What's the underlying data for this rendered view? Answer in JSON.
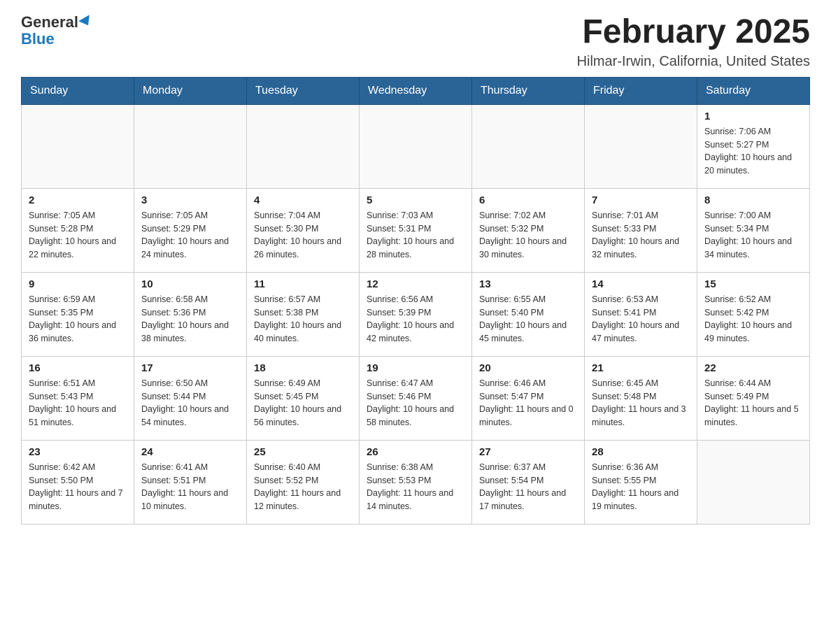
{
  "header": {
    "logo_general": "General",
    "logo_blue": "Blue",
    "month_title": "February 2025",
    "location": "Hilmar-Irwin, California, United States"
  },
  "weekdays": [
    "Sunday",
    "Monday",
    "Tuesday",
    "Wednesday",
    "Thursday",
    "Friday",
    "Saturday"
  ],
  "weeks": [
    [
      {
        "day": "",
        "sunrise": "",
        "sunset": "",
        "daylight": ""
      },
      {
        "day": "",
        "sunrise": "",
        "sunset": "",
        "daylight": ""
      },
      {
        "day": "",
        "sunrise": "",
        "sunset": "",
        "daylight": ""
      },
      {
        "day": "",
        "sunrise": "",
        "sunset": "",
        "daylight": ""
      },
      {
        "day": "",
        "sunrise": "",
        "sunset": "",
        "daylight": ""
      },
      {
        "day": "",
        "sunrise": "",
        "sunset": "",
        "daylight": ""
      },
      {
        "day": "1",
        "sunrise": "Sunrise: 7:06 AM",
        "sunset": "Sunset: 5:27 PM",
        "daylight": "Daylight: 10 hours and 20 minutes."
      }
    ],
    [
      {
        "day": "2",
        "sunrise": "Sunrise: 7:05 AM",
        "sunset": "Sunset: 5:28 PM",
        "daylight": "Daylight: 10 hours and 22 minutes."
      },
      {
        "day": "3",
        "sunrise": "Sunrise: 7:05 AM",
        "sunset": "Sunset: 5:29 PM",
        "daylight": "Daylight: 10 hours and 24 minutes."
      },
      {
        "day": "4",
        "sunrise": "Sunrise: 7:04 AM",
        "sunset": "Sunset: 5:30 PM",
        "daylight": "Daylight: 10 hours and 26 minutes."
      },
      {
        "day": "5",
        "sunrise": "Sunrise: 7:03 AM",
        "sunset": "Sunset: 5:31 PM",
        "daylight": "Daylight: 10 hours and 28 minutes."
      },
      {
        "day": "6",
        "sunrise": "Sunrise: 7:02 AM",
        "sunset": "Sunset: 5:32 PM",
        "daylight": "Daylight: 10 hours and 30 minutes."
      },
      {
        "day": "7",
        "sunrise": "Sunrise: 7:01 AM",
        "sunset": "Sunset: 5:33 PM",
        "daylight": "Daylight: 10 hours and 32 minutes."
      },
      {
        "day": "8",
        "sunrise": "Sunrise: 7:00 AM",
        "sunset": "Sunset: 5:34 PM",
        "daylight": "Daylight: 10 hours and 34 minutes."
      }
    ],
    [
      {
        "day": "9",
        "sunrise": "Sunrise: 6:59 AM",
        "sunset": "Sunset: 5:35 PM",
        "daylight": "Daylight: 10 hours and 36 minutes."
      },
      {
        "day": "10",
        "sunrise": "Sunrise: 6:58 AM",
        "sunset": "Sunset: 5:36 PM",
        "daylight": "Daylight: 10 hours and 38 minutes."
      },
      {
        "day": "11",
        "sunrise": "Sunrise: 6:57 AM",
        "sunset": "Sunset: 5:38 PM",
        "daylight": "Daylight: 10 hours and 40 minutes."
      },
      {
        "day": "12",
        "sunrise": "Sunrise: 6:56 AM",
        "sunset": "Sunset: 5:39 PM",
        "daylight": "Daylight: 10 hours and 42 minutes."
      },
      {
        "day": "13",
        "sunrise": "Sunrise: 6:55 AM",
        "sunset": "Sunset: 5:40 PM",
        "daylight": "Daylight: 10 hours and 45 minutes."
      },
      {
        "day": "14",
        "sunrise": "Sunrise: 6:53 AM",
        "sunset": "Sunset: 5:41 PM",
        "daylight": "Daylight: 10 hours and 47 minutes."
      },
      {
        "day": "15",
        "sunrise": "Sunrise: 6:52 AM",
        "sunset": "Sunset: 5:42 PM",
        "daylight": "Daylight: 10 hours and 49 minutes."
      }
    ],
    [
      {
        "day": "16",
        "sunrise": "Sunrise: 6:51 AM",
        "sunset": "Sunset: 5:43 PM",
        "daylight": "Daylight: 10 hours and 51 minutes."
      },
      {
        "day": "17",
        "sunrise": "Sunrise: 6:50 AM",
        "sunset": "Sunset: 5:44 PM",
        "daylight": "Daylight: 10 hours and 54 minutes."
      },
      {
        "day": "18",
        "sunrise": "Sunrise: 6:49 AM",
        "sunset": "Sunset: 5:45 PM",
        "daylight": "Daylight: 10 hours and 56 minutes."
      },
      {
        "day": "19",
        "sunrise": "Sunrise: 6:47 AM",
        "sunset": "Sunset: 5:46 PM",
        "daylight": "Daylight: 10 hours and 58 minutes."
      },
      {
        "day": "20",
        "sunrise": "Sunrise: 6:46 AM",
        "sunset": "Sunset: 5:47 PM",
        "daylight": "Daylight: 11 hours and 0 minutes."
      },
      {
        "day": "21",
        "sunrise": "Sunrise: 6:45 AM",
        "sunset": "Sunset: 5:48 PM",
        "daylight": "Daylight: 11 hours and 3 minutes."
      },
      {
        "day": "22",
        "sunrise": "Sunrise: 6:44 AM",
        "sunset": "Sunset: 5:49 PM",
        "daylight": "Daylight: 11 hours and 5 minutes."
      }
    ],
    [
      {
        "day": "23",
        "sunrise": "Sunrise: 6:42 AM",
        "sunset": "Sunset: 5:50 PM",
        "daylight": "Daylight: 11 hours and 7 minutes."
      },
      {
        "day": "24",
        "sunrise": "Sunrise: 6:41 AM",
        "sunset": "Sunset: 5:51 PM",
        "daylight": "Daylight: 11 hours and 10 minutes."
      },
      {
        "day": "25",
        "sunrise": "Sunrise: 6:40 AM",
        "sunset": "Sunset: 5:52 PM",
        "daylight": "Daylight: 11 hours and 12 minutes."
      },
      {
        "day": "26",
        "sunrise": "Sunrise: 6:38 AM",
        "sunset": "Sunset: 5:53 PM",
        "daylight": "Daylight: 11 hours and 14 minutes."
      },
      {
        "day": "27",
        "sunrise": "Sunrise: 6:37 AM",
        "sunset": "Sunset: 5:54 PM",
        "daylight": "Daylight: 11 hours and 17 minutes."
      },
      {
        "day": "28",
        "sunrise": "Sunrise: 6:36 AM",
        "sunset": "Sunset: 5:55 PM",
        "daylight": "Daylight: 11 hours and 19 minutes."
      },
      {
        "day": "",
        "sunrise": "",
        "sunset": "",
        "daylight": ""
      }
    ]
  ]
}
